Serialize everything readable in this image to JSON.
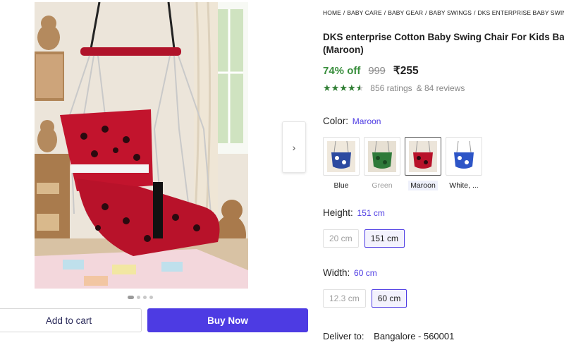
{
  "breadcrumb": [
    "HOME",
    "BABY CARE",
    "BABY GEAR",
    "BABY SWINGS",
    "DKS ENTERPRISE BABY SWINGS"
  ],
  "product": {
    "title_line1": "DKS enterprise Cotton Baby Swing Chair For Kids Baby",
    "title_line2": "(Maroon)",
    "discount": "74% off",
    "mrp": "999",
    "price": "₹255",
    "rating_value": 4.5,
    "ratings_text": "856 ratings",
    "reviews_text": "& 84 reviews"
  },
  "gallery": {
    "image_count": 4,
    "active_index": 0,
    "next_icon": "chevron-right-icon"
  },
  "actions": {
    "add_to_cart": "Add to cart",
    "buy_now": "Buy Now"
  },
  "color": {
    "label": "Color:",
    "selected": "Maroon",
    "options": [
      "Blue",
      "Green",
      "Maroon",
      "White, ..."
    ]
  },
  "height": {
    "label": "Height:",
    "selected": "151 cm",
    "options": [
      "20 cm",
      "151 cm"
    ]
  },
  "width": {
    "label": "Width:",
    "selected": "60 cm",
    "options": [
      "12.3 cm",
      "60 cm"
    ]
  },
  "delivery": {
    "label": "Deliver to:",
    "location": "Bangalore - 560001"
  },
  "colors": {
    "accent": "#4d3be3",
    "discount_green": "#388e3c",
    "star_green": "#2e7d32"
  }
}
